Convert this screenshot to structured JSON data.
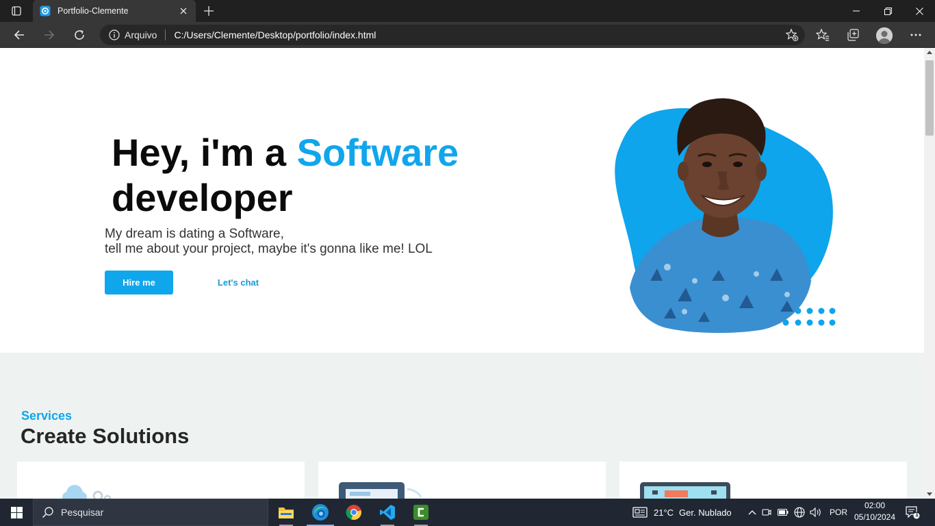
{
  "browser": {
    "tab": {
      "title": "Portfolio-Clemente",
      "favicon": "edge-page-icon"
    },
    "address": {
      "label": "Arquivo",
      "url": "C:/Users/Clemente/Desktop/portfolio/index.html"
    },
    "icons": [
      "tab-actions-icon",
      "close-tab-icon",
      "new-tab-icon",
      "minimize-icon",
      "restore-icon",
      "close-window-icon",
      "back-icon",
      "forward-icon",
      "refresh-icon",
      "info-icon",
      "add-favorite-icon",
      "favorites-icon",
      "collections-icon",
      "profile-icon",
      "more-icon"
    ]
  },
  "page": {
    "hero": {
      "heading_pre": "Hey, i'm a ",
      "heading_accent": "Software",
      "heading_post": "developer",
      "desc_line1": "My dream is dating a Software,",
      "desc_line2": "tell me about your project, maybe it's gonna like me! LOL",
      "hire_label": "Hire me",
      "chat_label": "Let's chat"
    },
    "services": {
      "subtitle": "Services",
      "title": "Create Solutions"
    }
  },
  "taskbar": {
    "search_placeholder": "Pesquisar",
    "weather_temp": "21°C",
    "weather_desc": "Ger. Nublado",
    "language": "POR",
    "time": "02:00",
    "date": "05/10/2024",
    "notifications": "1",
    "apps": [
      "file-explorer-icon",
      "edge-icon",
      "chrome-icon",
      "vscode-icon",
      "camtasia-icon"
    ]
  },
  "colors": {
    "accent": "#10a6ec",
    "browser_chrome": "#202020",
    "toolbar": "#373737",
    "services_bg": "#eef3f2",
    "taskbar": "#202733"
  }
}
